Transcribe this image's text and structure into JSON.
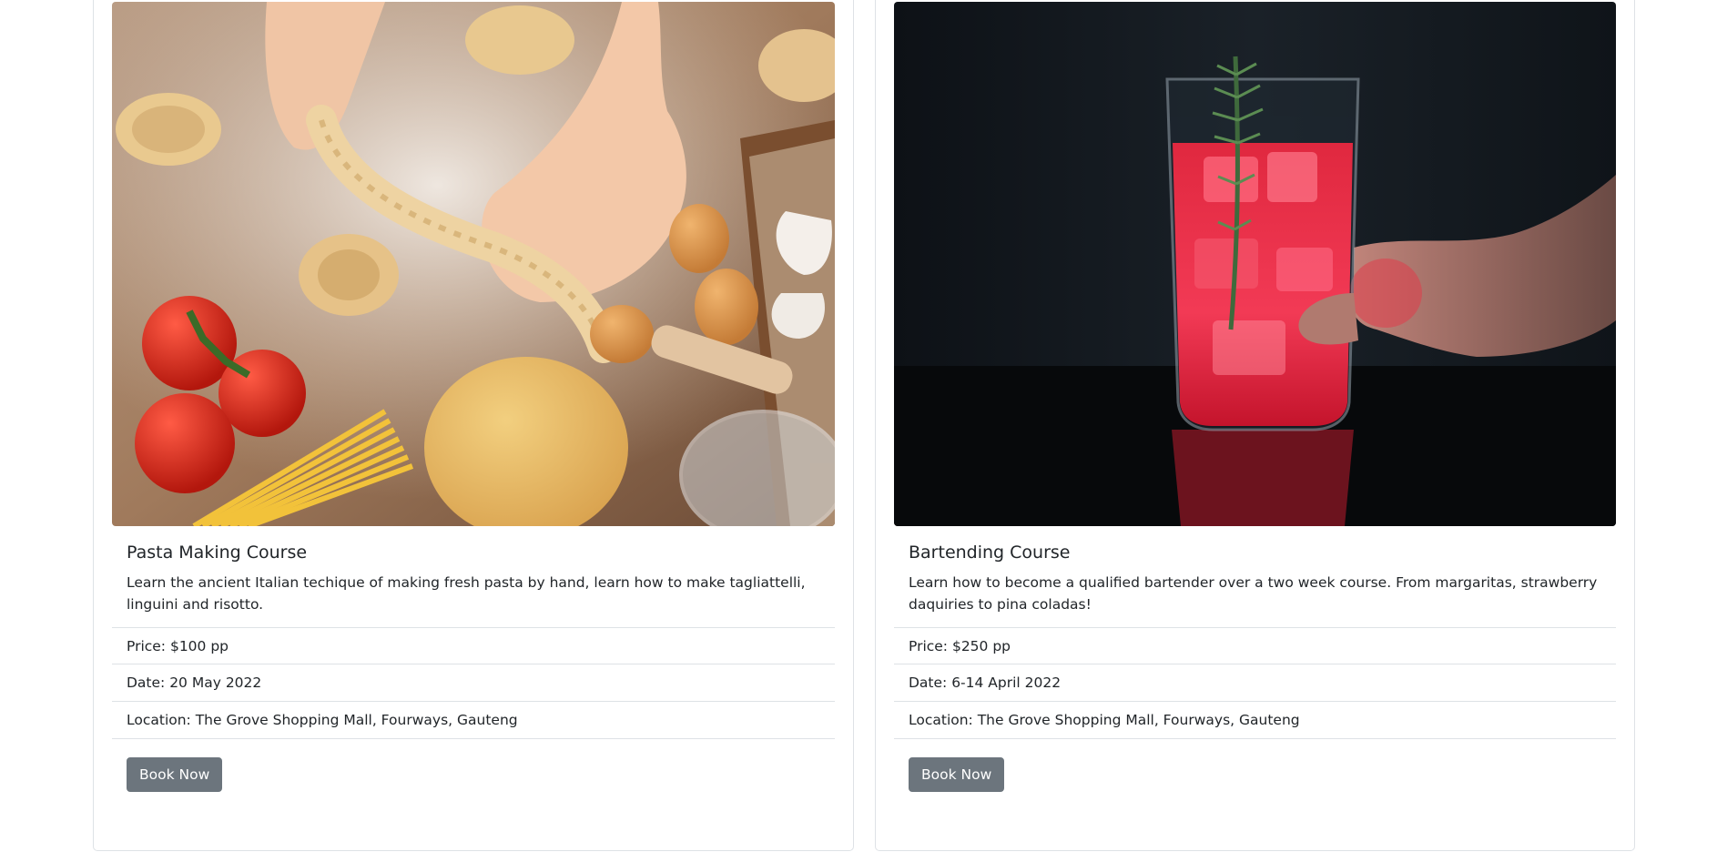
{
  "courses": [
    {
      "title": "Pasta Making Course",
      "description": "Learn the ancient Italian techique of making fresh pasta by hand, learn how to make tagliattelli, linguini and risotto.",
      "price": "Price: $100 pp",
      "date": "Date: 20 May 2022",
      "location": "Location: The Grove Shopping Mall, Fourways, Gauteng",
      "button_label": "Book Now",
      "image": "pasta-photo"
    },
    {
      "title": "Bartending Course",
      "description": "Learn how to become a qualified bartender over a two week course. From margaritas, strawberry daquiries to pina coladas!",
      "price": "Price: $250 pp",
      "date": "Date: 6-14 April 2022",
      "location": "Location: The Grove Shopping Mall, Fourways, Gauteng",
      "button_label": "Book Now",
      "image": "cocktail-photo"
    }
  ],
  "colors": {
    "button_bg": "#6c757d",
    "border": "#dee2e6",
    "text": "#212529"
  }
}
